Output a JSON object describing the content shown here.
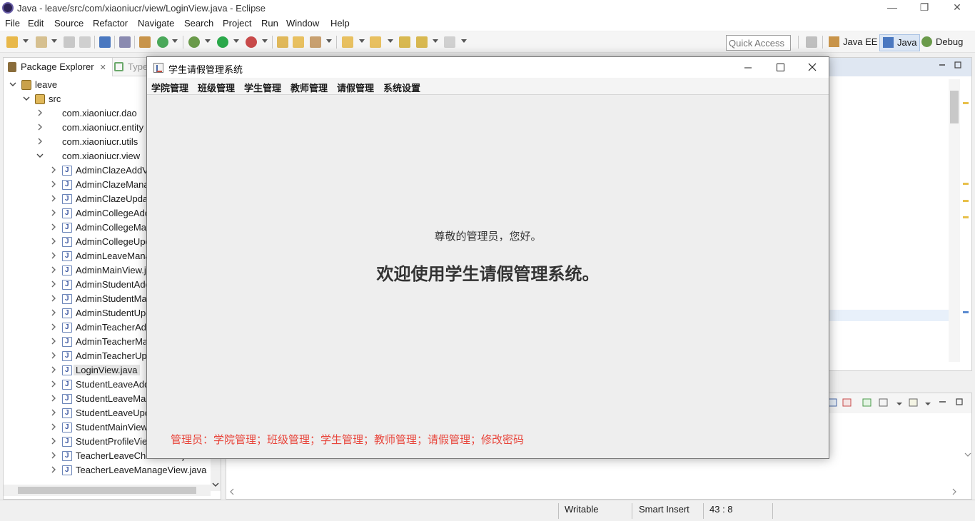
{
  "window": {
    "title": "Java - leave/src/com/xiaoniucr/view/LoginView.java - Eclipse",
    "minimize_glyph": "—",
    "restore_glyph": "❐",
    "close_glyph": "✕"
  },
  "menubar": [
    "File",
    "Edit",
    "Source",
    "Refactor",
    "Navigate",
    "Search",
    "Project",
    "Run",
    "Window",
    "Help"
  ],
  "toolbar": {
    "quick_access_placeholder": "Quick Access",
    "perspectives": [
      {
        "label": "Java EE",
        "active": false
      },
      {
        "label": "Java",
        "active": true
      },
      {
        "label": "Debug",
        "active": false
      }
    ]
  },
  "package_explorer": {
    "tab_label": "Package Explorer",
    "tab_close": "✕",
    "type_tab_label": "Type",
    "tree": [
      {
        "label": "leave",
        "type": "project",
        "level": 0,
        "twisty": "v"
      },
      {
        "label": "src",
        "type": "src",
        "level": 1,
        "twisty": "v"
      },
      {
        "label": "com.xiaoniucr.dao",
        "type": "package",
        "level": 2,
        "twisty": ">"
      },
      {
        "label": "com.xiaoniucr.entity",
        "type": "package",
        "level": 2,
        "twisty": ">"
      },
      {
        "label": "com.xiaoniucr.utils",
        "type": "package",
        "level": 2,
        "twisty": ">"
      },
      {
        "label": "com.xiaoniucr.view",
        "type": "package",
        "level": 2,
        "twisty": "v"
      },
      {
        "label": "AdminClazeAddView.java",
        "type": "java",
        "level": 3,
        "twisty": ">"
      },
      {
        "label": "AdminClazeManageView.java",
        "type": "java",
        "level": 3,
        "twisty": ">"
      },
      {
        "label": "AdminClazeUpdateView.java",
        "type": "java",
        "level": 3,
        "twisty": ">"
      },
      {
        "label": "AdminCollegeAddView.java",
        "type": "java",
        "level": 3,
        "twisty": ">"
      },
      {
        "label": "AdminCollegeManageView.java",
        "type": "java",
        "level": 3,
        "twisty": ">"
      },
      {
        "label": "AdminCollegeUpdateView.java",
        "type": "java",
        "level": 3,
        "twisty": ">"
      },
      {
        "label": "AdminLeaveManageView.java",
        "type": "java",
        "level": 3,
        "twisty": ">"
      },
      {
        "label": "AdminMainView.java",
        "type": "java",
        "level": 3,
        "twisty": ">"
      },
      {
        "label": "AdminStudentAddView.java",
        "type": "java",
        "level": 3,
        "twisty": ">"
      },
      {
        "label": "AdminStudentManageView.java",
        "type": "java",
        "level": 3,
        "twisty": ">"
      },
      {
        "label": "AdminStudentUpdateView.java",
        "type": "java",
        "level": 3,
        "twisty": ">"
      },
      {
        "label": "AdminTeacherAddView.java",
        "type": "java",
        "level": 3,
        "twisty": ">"
      },
      {
        "label": "AdminTeacherManageView.java",
        "type": "java",
        "level": 3,
        "twisty": ">"
      },
      {
        "label": "AdminTeacherUpdateView.java",
        "type": "java",
        "level": 3,
        "twisty": ">"
      },
      {
        "label": "LoginView.java",
        "type": "java",
        "level": 3,
        "twisty": ">",
        "selected": true
      },
      {
        "label": "StudentLeaveAddView.java",
        "type": "java",
        "level": 3,
        "twisty": ">"
      },
      {
        "label": "StudentLeaveManageView.java",
        "type": "java",
        "level": 3,
        "twisty": ">"
      },
      {
        "label": "StudentLeaveUpdateView.java",
        "type": "java",
        "level": 3,
        "twisty": ">"
      },
      {
        "label": "StudentMainView.java",
        "type": "java",
        "level": 3,
        "twisty": ">"
      },
      {
        "label": "StudentProfileView.java",
        "type": "java",
        "level": 3,
        "twisty": ">"
      },
      {
        "label": "TeacherLeaveCheckView.java",
        "type": "java",
        "level": 3,
        "twisty": ">"
      },
      {
        "label": "TeacherLeaveManageView.java",
        "type": "java",
        "level": 3,
        "twisty": ">"
      }
    ]
  },
  "statusbar": {
    "writable": "Writable",
    "insert_mode": "Smart Insert",
    "position": "43 : 8"
  },
  "dialog": {
    "title": "学生请假管理系统",
    "menus": [
      "学院管理",
      "班级管理",
      "学生管理",
      "教师管理",
      "请假管理",
      "系统设置"
    ],
    "greeting": "尊敬的管理员，您好。",
    "welcome": "欢迎使用学生请假管理系统。",
    "permissions": "管理员：学院管理；班级管理；学生管理；教师管理；请假管理；修改密码"
  }
}
